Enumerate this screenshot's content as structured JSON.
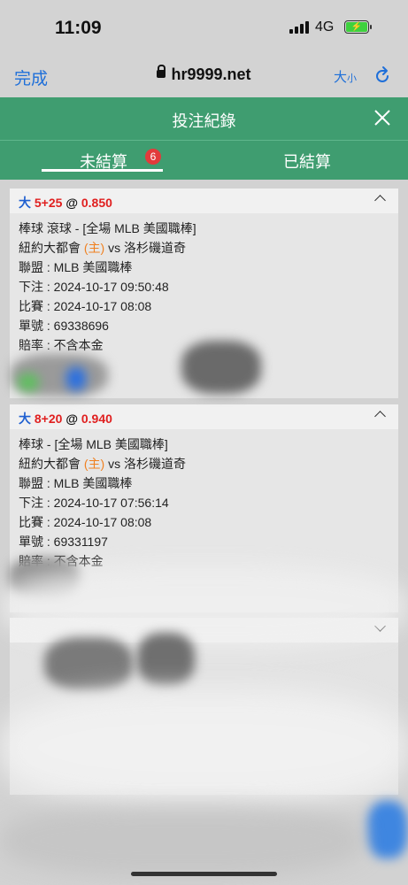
{
  "status_bar": {
    "time": "11:09",
    "network": "4G"
  },
  "browser": {
    "done_label": "完成",
    "url": "hr9999.net",
    "font_size_label": "大",
    "font_size_small": "小"
  },
  "header": {
    "title": "投注紀錄"
  },
  "tabs": [
    {
      "label": "未結算",
      "badge": "6"
    },
    {
      "label": "已結算"
    }
  ],
  "bets": [
    {
      "side": "大",
      "line": "5+25",
      "at": "@",
      "odds": "0.850",
      "match_type": "棒球 滾球 - [全場 MLB 美國職棒]",
      "home_team": "紐約大都會",
      "home_tag": "(主)",
      "vs": "vs",
      "away_team": "洛杉磯道奇",
      "league": "聯盟 : MLB 美國職棒",
      "bet_time": "下注 : 2024-10-17 09:50:48",
      "match_time": "比賽 : 2024-10-17 08:08",
      "ticket": "單號 : 69338696",
      "odds_note": "賠率 : 不含本金"
    },
    {
      "side": "大",
      "line": "8+20",
      "at": "@",
      "odds": "0.940",
      "match_type": "棒球 - [全場 MLB 美國職棒]",
      "home_team": "紐約大都會",
      "home_tag": "(主)",
      "vs": "vs",
      "away_team": "洛杉磯道奇",
      "league": "聯盟 : MLB 美國職棒",
      "bet_time": "下注 : 2024-10-17 07:56:14",
      "match_time": "比賽 : 2024-10-17 08:08",
      "ticket": "單號 : 69331197",
      "odds_note": "賠率 : 不含本金"
    }
  ],
  "colors": {
    "accent_green": "#3f9d70",
    "link_blue": "#1e6fd9",
    "odds_red": "#e02020",
    "home_orange": "#f08020"
  }
}
